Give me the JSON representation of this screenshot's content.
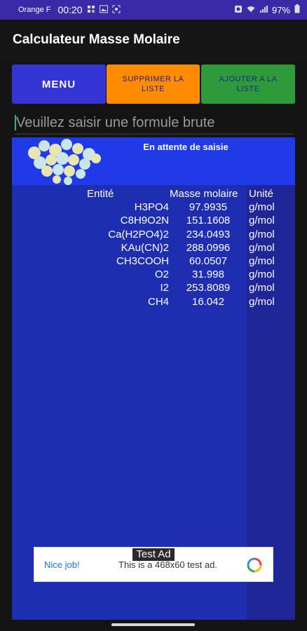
{
  "status_bar": {
    "carrier": "Orange F",
    "time": "00:20",
    "battery": "97%",
    "icons": [
      "notification-icon",
      "image-icon",
      "scan-icon",
      "alarm-icon",
      "wifi-icon",
      "signal-icon",
      "battery-icon"
    ]
  },
  "app": {
    "title": "Calculateur Masse Molaire"
  },
  "buttons": {
    "menu": "MENU",
    "delete_list": "SUPPRIMER LA LISTE",
    "add_list": "AJOUTER A LA LISTE"
  },
  "input": {
    "placeholder": "Veuillez saisir une formule brute",
    "value": ""
  },
  "panel": {
    "status": "En attente de saisie"
  },
  "table": {
    "headers": {
      "entity": "Entité",
      "mass": "Masse molaire",
      "unit": "Unité"
    },
    "rows": [
      {
        "entity": "H3PO4",
        "mass": "97.9935",
        "unit": "g/mol"
      },
      {
        "entity": "C8H9O2N",
        "mass": "151.1608",
        "unit": "g/mol"
      },
      {
        "entity": "Ca(H2PO4)2",
        "mass": "234.0493",
        "unit": "g/mol"
      },
      {
        "entity": "KAu(CN)2",
        "mass": "288.0996",
        "unit": "g/mol"
      },
      {
        "entity": "CH3COOH",
        "mass": "60.0507",
        "unit": "g/mol"
      },
      {
        "entity": "O2",
        "mass": "31.998",
        "unit": "g/mol"
      },
      {
        "entity": "I2",
        "mass": "253.8089",
        "unit": "g/mol"
      },
      {
        "entity": "CH4",
        "mass": "16.042",
        "unit": "g/mol"
      }
    ]
  },
  "ad": {
    "label": "Test Ad",
    "cta": "Nice job!",
    "text": "This is a 468x60 test ad."
  },
  "colors": {
    "status_bar": "#3b2aa8",
    "menu_button": "#3535d5",
    "delete_button": "#ff8c00",
    "add_button": "#2f9a3a",
    "panel": "#1e2eb0"
  }
}
